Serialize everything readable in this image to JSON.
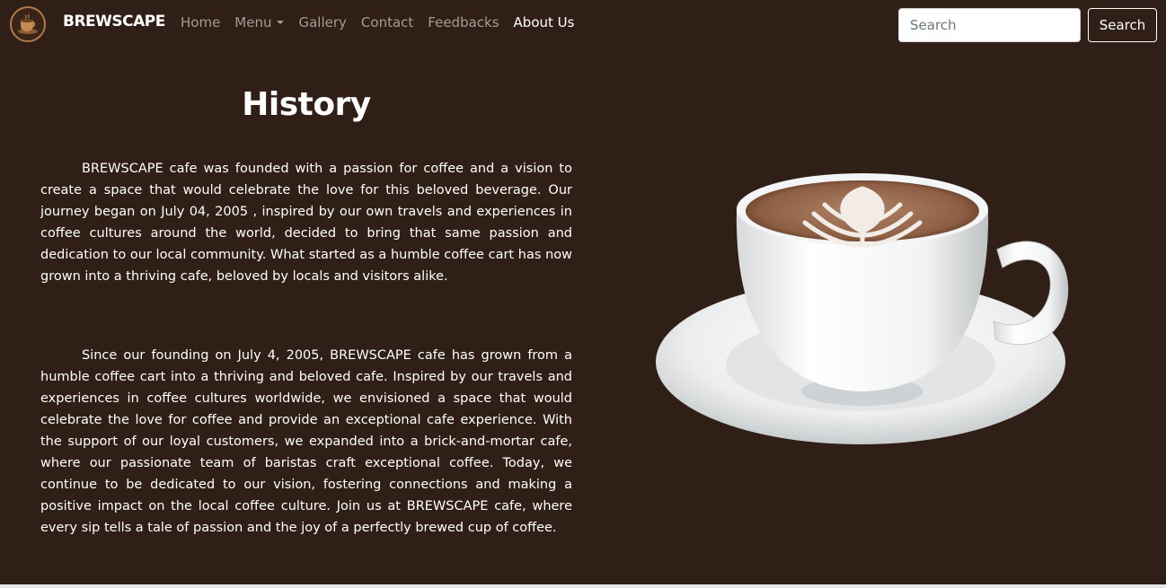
{
  "brand": {
    "name": "BREWSCAPE",
    "logo_icon": "coffee-cup-logo-icon"
  },
  "nav": {
    "items": [
      {
        "label": "Home",
        "active": false
      },
      {
        "label": "Menu",
        "active": false,
        "dropdown": true
      },
      {
        "label": "Gallery",
        "active": false
      },
      {
        "label": "Contact",
        "active": false
      },
      {
        "label": "Feedbacks",
        "active": false
      },
      {
        "label": "About Us",
        "active": true
      }
    ]
  },
  "search": {
    "placeholder": "Search",
    "value": "",
    "button_label": "Search"
  },
  "main": {
    "title": "History",
    "paragraphs": [
      "BREWSCAPE cafe was founded with a passion for coffee and a vision to create a space that would celebrate the love for this beloved beverage. Our journey began on July 04, 2005 , inspired by our own travels and experiences in coffee cultures around the world, decided to bring that same passion and dedication to our local community. What started as a humble coffee cart has now grown into a thriving cafe, beloved by locals and visitors alike.",
      "Since our founding on July 4, 2005, BREWSCAPE cafe has grown from a humble coffee cart into a thriving and beloved cafe. Inspired by our travels and experiences in coffee cultures worldwide, we envisioned a space that would celebrate the love for coffee and provide an exceptional cafe experience. With the support of our loyal customers, we expanded into a brick-and-mortar cafe, where our passionate team of baristas craft exceptional coffee. Today, we continue to be dedicated to our vision, fostering connections and making a positive impact on the local coffee culture. Join us at BREWSCAPE cafe, where every sip tells a tale of passion and the joy of a perfectly brewed cup of coffee."
    ],
    "image_icon": "latte-cup-image"
  },
  "colors": {
    "background": "#2f1f16",
    "nav_inactive": "#a59c95",
    "nav_active": "#ffffff",
    "accent": "#b07a4a"
  }
}
